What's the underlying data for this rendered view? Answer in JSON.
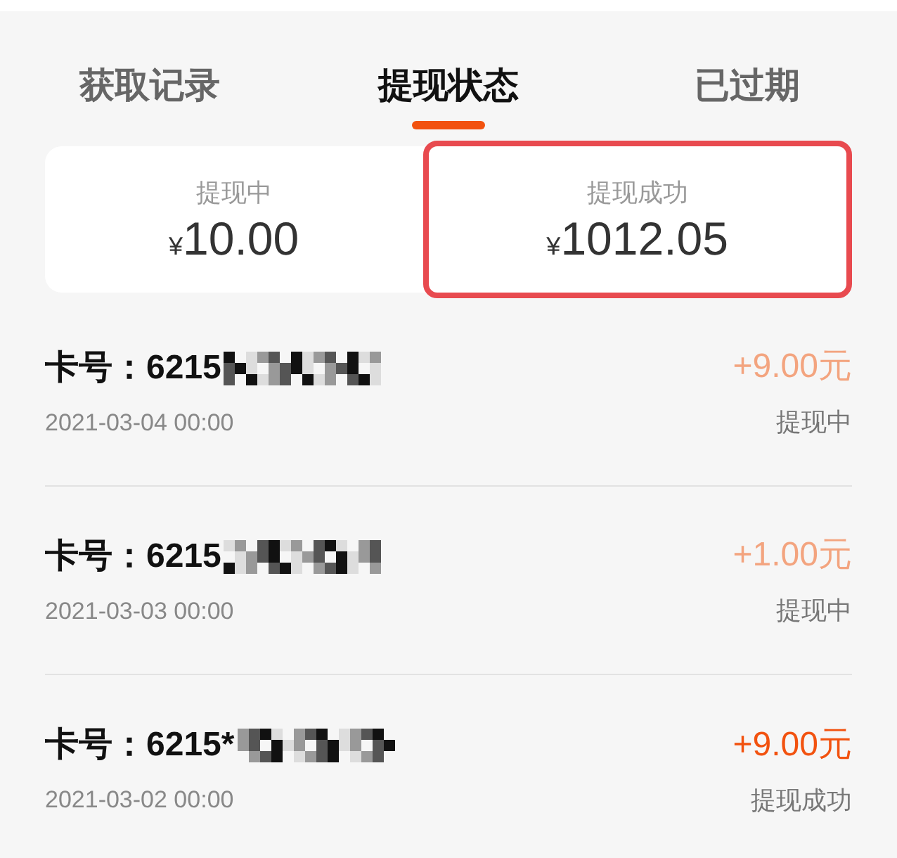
{
  "tabs": [
    {
      "label": "获取记录",
      "selected": false
    },
    {
      "label": "提现状态",
      "selected": true
    },
    {
      "label": "已过期",
      "selected": false
    }
  ],
  "summary": [
    {
      "label": "提现中",
      "currency": "¥",
      "amount": "10.00",
      "highlighted": false
    },
    {
      "label": "提现成功",
      "currency": "¥",
      "amount": "1012.05",
      "highlighted": true
    }
  ],
  "records": [
    {
      "card": "卡号：6215",
      "date": "2021-03-04 00:00",
      "amount": "+9.00元",
      "status": "提现中",
      "kind": "pending"
    },
    {
      "card": "卡号：6215",
      "date": "2021-03-03 00:00",
      "amount": "+1.00元",
      "status": "提现中",
      "kind": "pending"
    },
    {
      "card": "卡号：6215*",
      "date": "2021-03-02 00:00",
      "amount": "+9.00元",
      "status": "提现成功",
      "kind": "success"
    }
  ]
}
